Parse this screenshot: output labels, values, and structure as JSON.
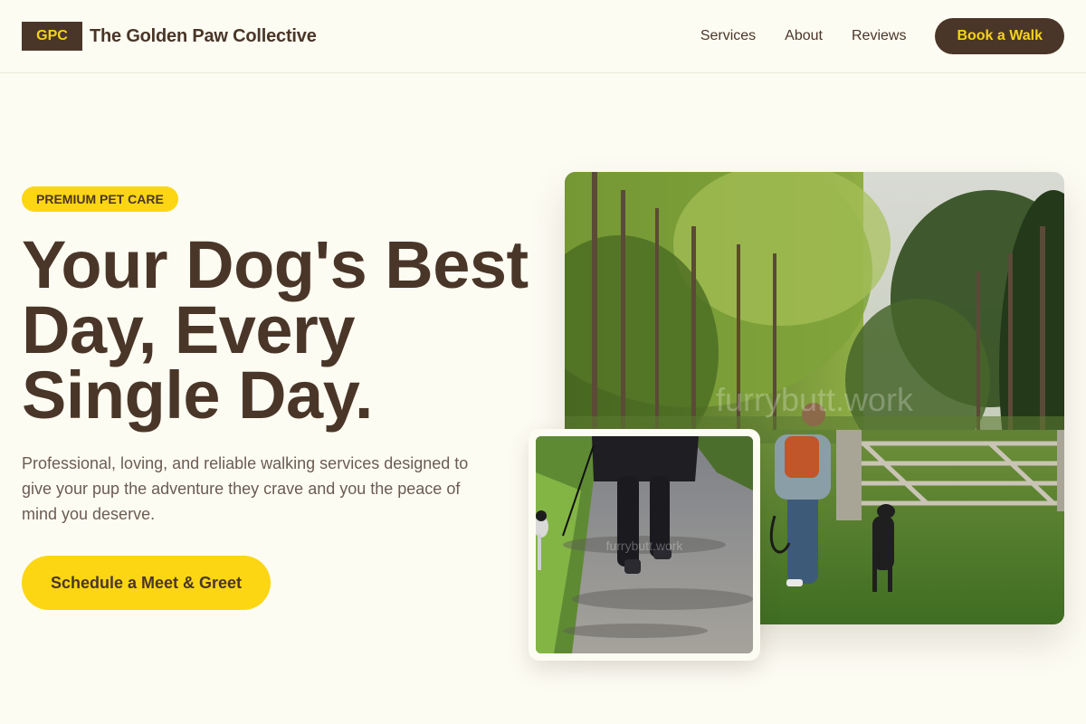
{
  "header": {
    "logo": "GPC",
    "brand_name": "The Golden Paw Collective",
    "nav": [
      "Services",
      "About",
      "Reviews"
    ],
    "book_button": "Book a Walk"
  },
  "hero": {
    "badge": "PREMIUM PET CARE",
    "title_lines": [
      "Your Dog's Best",
      "Day, Every",
      "Single Day."
    ],
    "description": "Professional, loving, and reliable walking services designed to give your pup the adventure they crave and you the peace of mind you deserve.",
    "cta": "Schedule a Meet & Greet"
  },
  "images": {
    "main_watermark": "furrybutt.work",
    "inset_watermark": "furrybutt.work"
  },
  "colors": {
    "brown": "#4a3628",
    "yellow": "#fcd612",
    "background": "#fdfcf3"
  }
}
